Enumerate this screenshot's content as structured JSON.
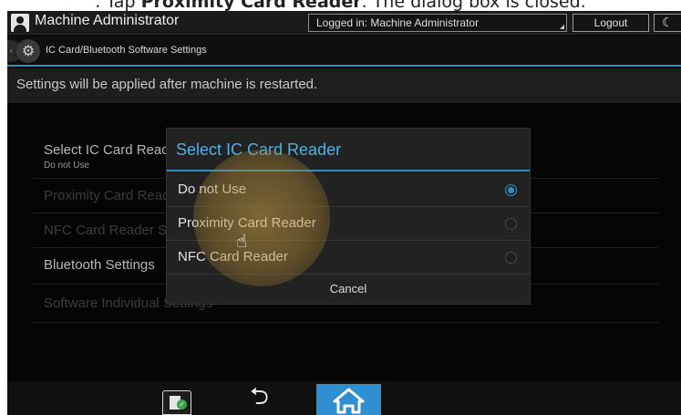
{
  "caption": {
    "prefix": ". Tap ",
    "bold": "Proximity Card Reader",
    "suffix": ". The dialog box is closed."
  },
  "titlebar": {
    "user_icon": "user-icon",
    "title": "Machine Administrator",
    "logged_in": "Logged in: Machine Administrator",
    "logout_label": "Logout",
    "night_icon": "moon-icon"
  },
  "subheader": {
    "back_icon": "chevron-left-icon",
    "settings_icon": "gear-icon",
    "title": "IC Card/Bluetooth Software Settings"
  },
  "notice": "Settings will be applied after machine is restarted.",
  "list": {
    "items": [
      {
        "label": "Select IC Card Reader",
        "sub": "Do not Use"
      },
      {
        "label": "Proximity Card Reader"
      },
      {
        "label": "NFC Card Reader Settings"
      },
      {
        "label": "Bluetooth Settings"
      },
      {
        "label": "Software Individual Settings"
      }
    ]
  },
  "dialog": {
    "title": "Select IC Card Reader",
    "options": [
      {
        "label": "Do not Use",
        "selected": true
      },
      {
        "label": "Proximity Card Reader",
        "selected": false
      },
      {
        "label": "NFC Card Reader",
        "selected": false
      }
    ],
    "cancel_label": "Cancel"
  },
  "bottombar": {
    "icons": [
      "card-check-icon",
      "back-arrow-icon",
      "home-icon"
    ]
  },
  "colors": {
    "accent": "#2d90c4",
    "home_button": "#2f8fd0",
    "background": "#050505"
  }
}
